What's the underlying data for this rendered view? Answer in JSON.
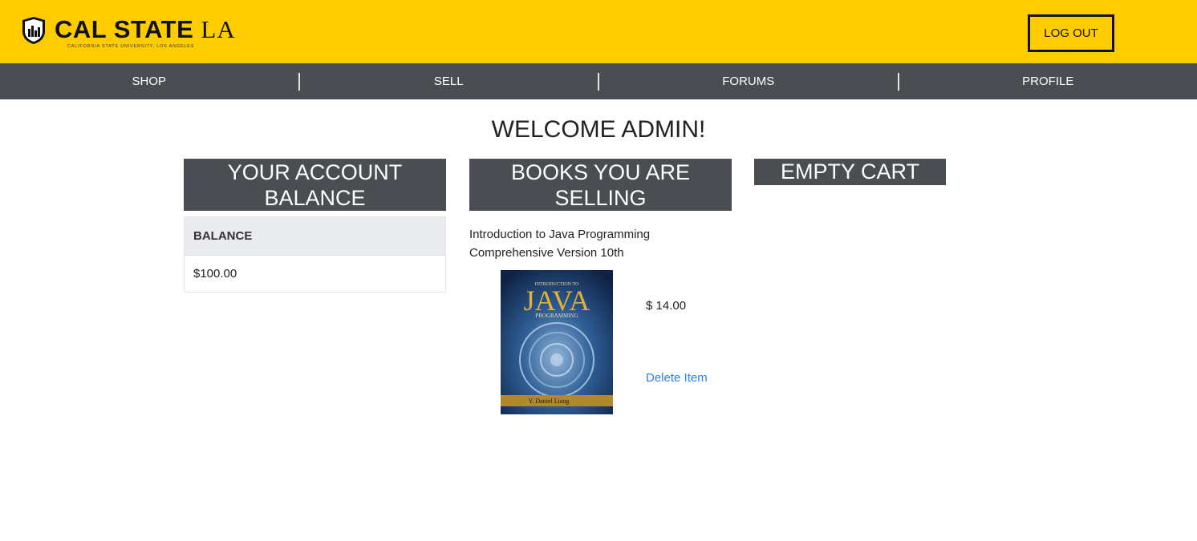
{
  "header": {
    "logo_bold": "CAL STATE",
    "logo_serif": "LA",
    "logo_sub": "CALIFORNIA STATE UNIVERSITY, LOS ANGELES",
    "logout_label": "LOG OUT",
    "brand_color": "#ffcc00"
  },
  "nav": {
    "items": [
      {
        "label": "SHOP"
      },
      {
        "label": "SELL"
      },
      {
        "label": "FORUMS"
      },
      {
        "label": "PROFILE"
      }
    ],
    "background": "#4a4d52"
  },
  "main": {
    "welcome": "WELCOME ADMIN!",
    "account": {
      "heading": "YOUR ACCOUNT BALANCE",
      "column_header": "BALANCE",
      "balance_value": "$100.00"
    },
    "selling": {
      "heading": "BOOKS YOU ARE SELLING",
      "books": [
        {
          "title": "Introduction to Java Programming Comprehensive Version 10th",
          "price": "$ 14.00",
          "delete_label": "Delete Item",
          "cover": {
            "top_text": "INTRODUCTION TO",
            "main_text": "JAVA",
            "sub_text": "PROGRAMMING",
            "author": "Y. Daniel Liang",
            "icon": "book-cover-image"
          }
        }
      ]
    },
    "cart": {
      "heading": "EMPTY CART"
    }
  },
  "colors": {
    "link": "#2e86de",
    "panel_header": "#4a4d52",
    "table_header_bg": "#e9ebee"
  }
}
